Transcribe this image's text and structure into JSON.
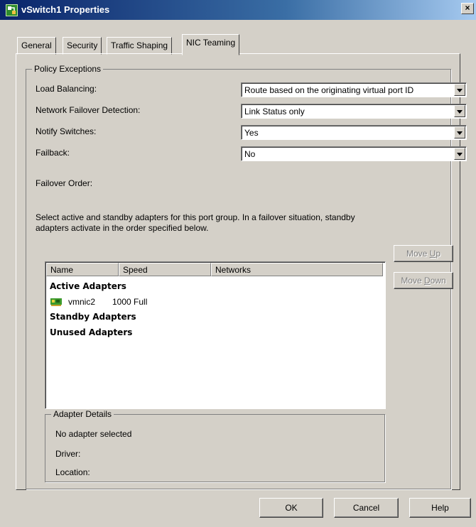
{
  "window": {
    "title": "vSwitch1 Properties",
    "close_glyph": "×",
    "app_icon": "vsphere-app-icon"
  },
  "tabs": [
    "General",
    "Security",
    "Traffic Shaping",
    "NIC Teaming"
  ],
  "active_tab": "NIC Teaming",
  "policy": {
    "legend": "Policy Exceptions",
    "load_balancing": {
      "label": "Load Balancing:",
      "value": "Route based on the originating virtual port ID"
    },
    "failover_detection": {
      "label": "Network Failover Detection:",
      "value": "Link Status only"
    },
    "notify_switches": {
      "label": "Notify Switches:",
      "value": "Yes"
    },
    "failback": {
      "label": "Failback:",
      "value": "No"
    },
    "failover_order_label": "Failover Order:",
    "description_line1": "Select active and standby adapters for this port group.  In a failover situation, standby",
    "description_line2": "adapters activate  in the order specified below."
  },
  "adapter_list": {
    "columns": [
      "Name",
      "Speed",
      "Networks"
    ],
    "active_group": "Active Adapters",
    "standby_group": "Standby Adapters",
    "unused_group": "Unused Adapters",
    "active_adapters": [
      {
        "name": "vmnic2",
        "speed": "1000 Full",
        "networks": ""
      }
    ]
  },
  "move_up": {
    "pre": "Move ",
    "key": "U",
    "post": "p"
  },
  "move_down": {
    "pre": "Move ",
    "key": "D",
    "post": "own"
  },
  "adapter_details": {
    "legend": "Adapter Details",
    "status": "No adapter selected",
    "driver_label": "Driver:",
    "location_label": "Location:"
  },
  "buttons": {
    "ok": "OK",
    "cancel": "Cancel",
    "help": "Help"
  },
  "colors": {
    "dialog_bg": "#d4d0c8",
    "titlebar_start": "#0a246a",
    "titlebar_end": "#a6caf0",
    "nic_icon_green": "#3c9a2c"
  },
  "icons": {
    "nic": "network-adapter-icon",
    "dropdown": "chevron-down-icon"
  }
}
